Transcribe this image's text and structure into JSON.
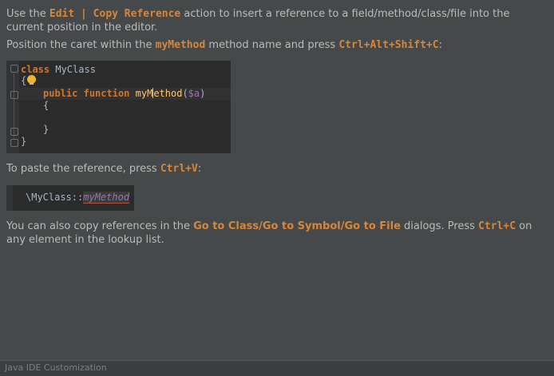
{
  "tip": {
    "p1_a": "Use the ",
    "p1_action": "Edit | Copy Reference",
    "p1_b": " action to insert a reference to a field/method/class/file into the current position in the editor.",
    "p2_a": "Position the caret within the ",
    "p2_method": "myMethod",
    "p2_b": " method name and press ",
    "p2_shortcut": "Ctrl+Alt+Shift+C",
    "p2_c": ":",
    "p3_a": "To paste the reference, press ",
    "p3_shortcut": "Ctrl+V",
    "p3_b": ":",
    "p4_a": "You can also copy references in the ",
    "p4_dialogs": "Go to Class/Go to Symbol/Go to File",
    "p4_b": " dialogs. Press ",
    "p4_shortcut": "Ctrl+C",
    "p4_c": " on any element in the lookup list."
  },
  "editor": {
    "l1_kw": "class",
    "l1_name": " MyClass",
    "l2": "{",
    "l3_kw1": "public",
    "l3_kw2": "function",
    "l3_fn_a": "myM",
    "l3_fn_b": "ethod",
    "l3_open": "(",
    "l3_param": "$a",
    "l3_close": ")",
    "l4": "{",
    "l6": "}",
    "l7": "}"
  },
  "paste": {
    "class_part": "\\MyClass::",
    "method_part": "myMethod"
  },
  "footer": {
    "label": "Java IDE Customization"
  },
  "colors": {
    "background": "#45494a",
    "accent": "#d7863a",
    "editor_bg": "#2b2b2b"
  },
  "icons": {
    "intention": "lightbulb-icon"
  }
}
